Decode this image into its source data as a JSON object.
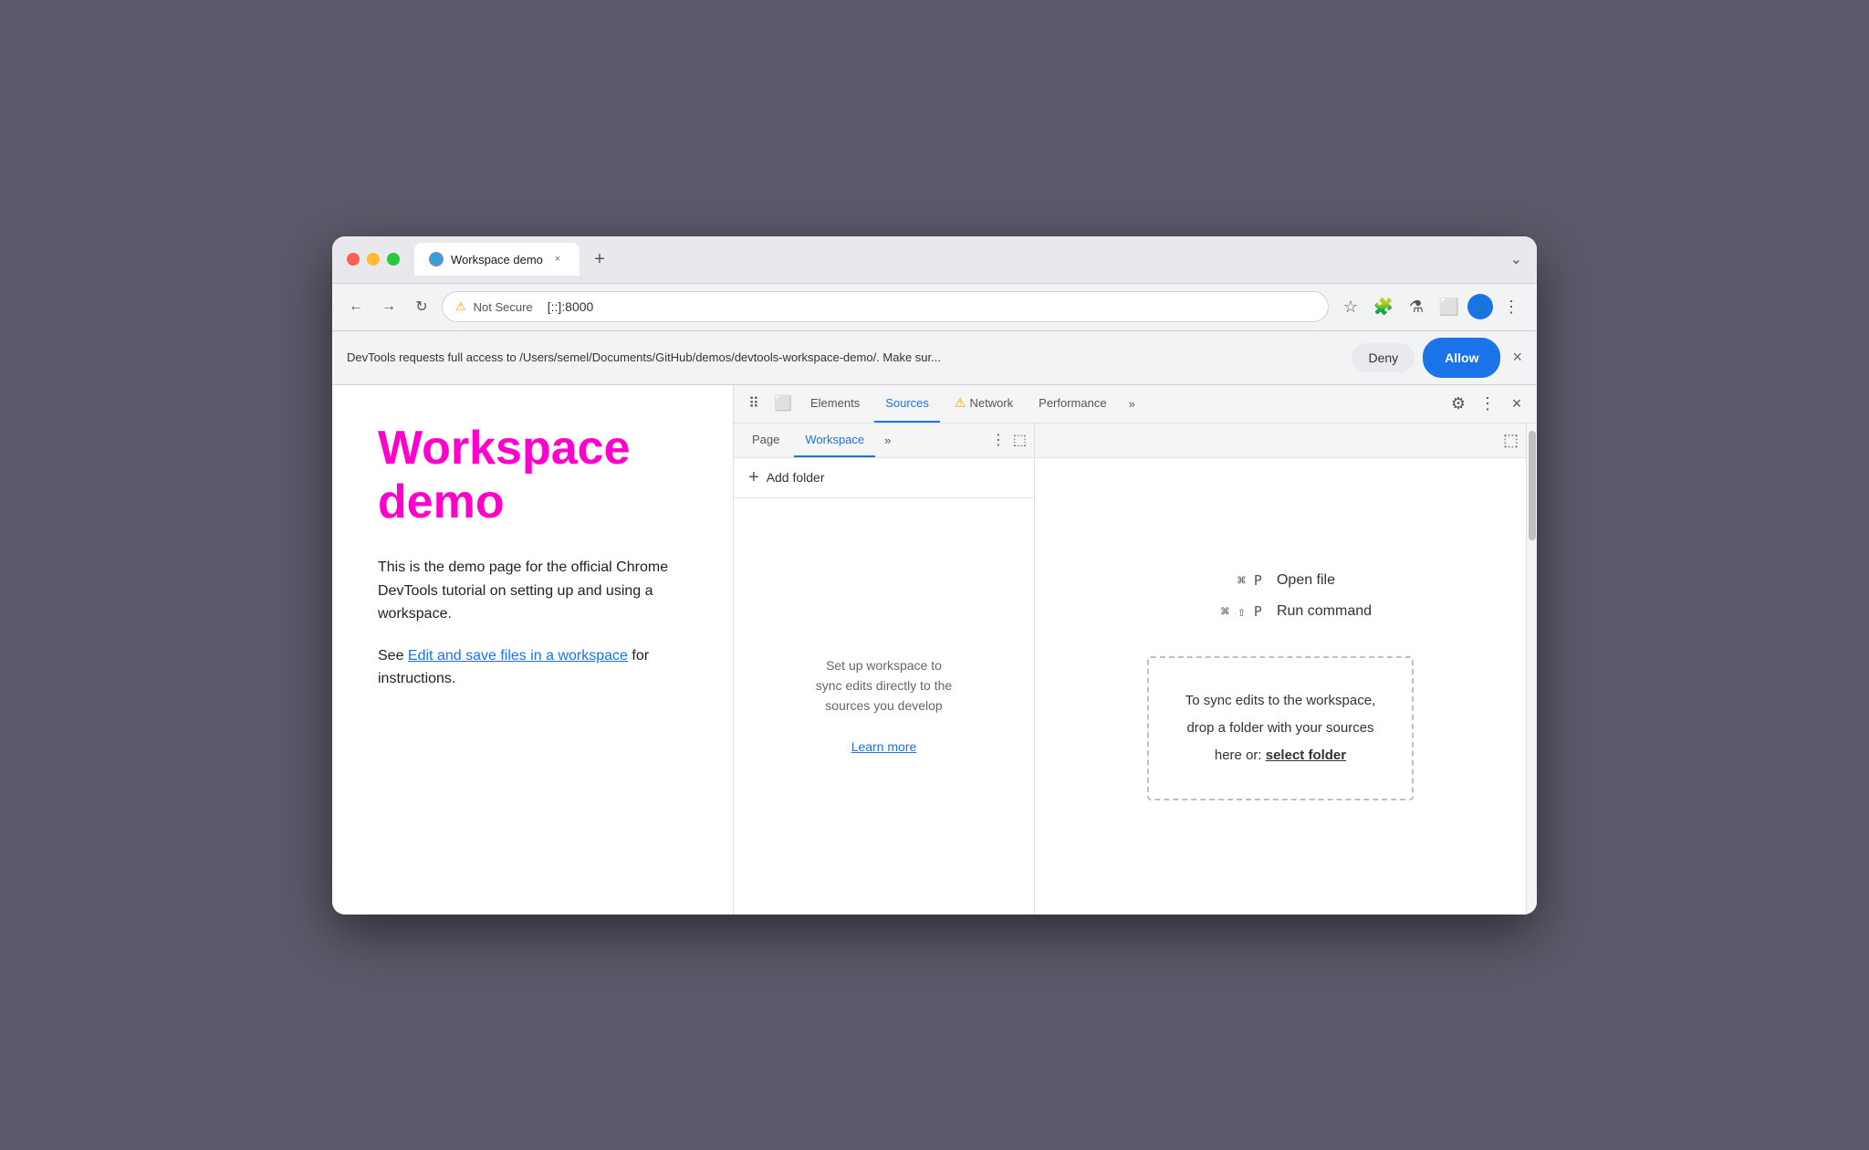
{
  "browser": {
    "title": "Workspace demo",
    "tab_close": "×",
    "tab_new": "+",
    "tab_dropdown": "⌄"
  },
  "addressbar": {
    "not_secure_label": "Not Secure",
    "url": "[::]:8000",
    "back": "←",
    "forward": "→",
    "refresh": "↻"
  },
  "notification": {
    "text": "DevTools requests full access to /Users/semel/Documents/GitHub/demos/devtools-workspace-demo/. Make sur...",
    "deny_label": "Deny",
    "allow_label": "Allow",
    "close": "×"
  },
  "webpage": {
    "title": "Workspace demo",
    "body1": "This is the demo page for the official Chrome DevTools tutorial on setting up and using a workspace.",
    "body2_prefix": "See ",
    "body2_link": "Edit and save files in a workspace",
    "body2_suffix": " for instructions."
  },
  "devtools": {
    "tabs": {
      "cursor_label": "⠿",
      "device_label": "⬜",
      "elements_label": "Elements",
      "sources_label": "Sources",
      "network_label": "Network",
      "performance_label": "Performance",
      "more_label": "»",
      "gear_label": "⚙",
      "kebab_label": "⋮",
      "close_label": "×"
    },
    "subtabs": {
      "page_label": "Page",
      "workspace_label": "Workspace",
      "more_label": "»",
      "kebab_label": "⋮",
      "layout_label": "⬚",
      "toggle_label": "⬚"
    },
    "add_folder_label": "Add folder",
    "workspace_empty_line1": "Set up workspace to",
    "workspace_empty_line2": "sync edits directly to the",
    "workspace_empty_line3": "sources you develop",
    "learn_more_label": "Learn more",
    "shortcut1_keys": "⌘ P",
    "shortcut1_label": "Open file",
    "shortcut2_keys": "⌘ ⇧ P",
    "shortcut2_label": "Run command",
    "drop_zone_line1": "To sync edits to the workspace,",
    "drop_zone_line2": "drop a folder with your sources",
    "drop_zone_line3_prefix": "here or: ",
    "drop_zone_link": "select folder"
  }
}
